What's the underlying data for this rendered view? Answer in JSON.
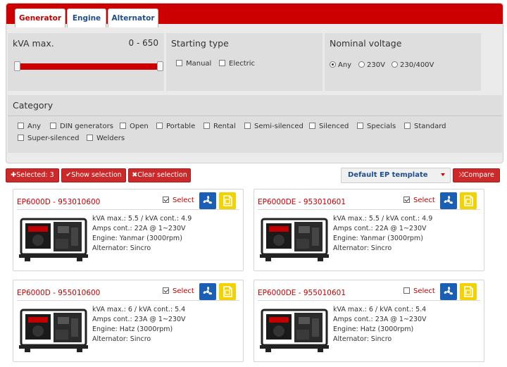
{
  "tabs": [
    {
      "label": "Generator",
      "active": true
    },
    {
      "label": "Engine",
      "active": false
    },
    {
      "label": "Alternator",
      "active": false
    }
  ],
  "kva": {
    "title": "kVA max.",
    "range": "0 - 650"
  },
  "starting_type": {
    "title": "Starting type",
    "options": [
      "Manual",
      "Electric"
    ]
  },
  "nominal_voltage": {
    "title": "Nominal voltage",
    "options": [
      "Any",
      "230V",
      "230/400V"
    ],
    "selected": "Any"
  },
  "category": {
    "title": "Category",
    "options": [
      "Any",
      "DIN generators",
      "Open",
      "Portable",
      "Rental",
      "Semi-silenced",
      "Silenced",
      "Specials",
      "Standard",
      "Super-silenced",
      "Welders"
    ]
  },
  "actions": {
    "selected": "Selected: 3",
    "show": "Show selection",
    "clear": "Clear selection",
    "template": "Default EP template",
    "compare": "Compare"
  },
  "products": [
    {
      "title": "EP6000D - 953010600",
      "select_label": "Select",
      "checked": true,
      "kva": "kVA max.: 5.5 / kVA cont.: 4.9",
      "amps": "Amps cont.: 22A @ 1~230V",
      "engine": "Engine: Yanmar (3000rpm)",
      "alternator": "Alternator: Sincro"
    },
    {
      "title": "EP6000DE - 953010601",
      "select_label": "Select",
      "checked": true,
      "kva": "kVA max.: 5.5 / kVA cont.: 4.9",
      "amps": "Amps cont.: 22A @ 1~230V",
      "engine": "Engine: Yanmar (3000rpm)",
      "alternator": "Alternator: Sincro"
    },
    {
      "title": "EP6000D - 955010600",
      "select_label": "Select",
      "checked": true,
      "kva": "kVA max.: 6 / kVA cont.: 5.4",
      "amps": "Amps cont.: 23A @ 1~230V",
      "engine": "Engine: Hatz (3000rpm)",
      "alternator": "Alternator: Sincro"
    },
    {
      "title": "EP6000DE - 955010601",
      "select_label": "Select",
      "checked": false,
      "kva": "kVA max.: 6 / kVA cont.: 5.4",
      "amps": "Amps cont.: 23A @ 1~230V",
      "engine": "Engine: Hatz (3000rpm)",
      "alternator": "Alternator: Sincro"
    }
  ],
  "icons": {
    "fan": "fan-icon",
    "fuel": "fuel-can-icon"
  },
  "colors": {
    "accent": "#cc0000",
    "link": "#1f4e8c",
    "fan": "#1a5fb4",
    "fuel": "#f2d200"
  }
}
